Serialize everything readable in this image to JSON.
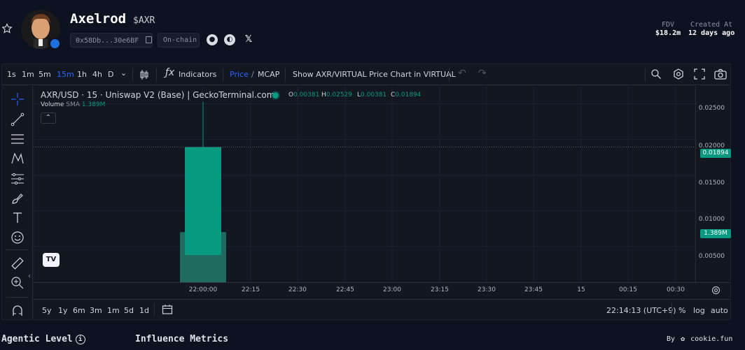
{
  "token": {
    "name": "Axelrod",
    "ticker": "$AXR",
    "address": "0x58Db...30e6BF",
    "chain_badge": "On-chain"
  },
  "stats": {
    "fdv_label": "FDV",
    "fdv_value": "$18.2m",
    "created_label": "Created At",
    "created_value": "12 days ago"
  },
  "toolbar": {
    "timeframes": [
      "1s",
      "1m",
      "5m",
      "15m",
      "1h",
      "4h",
      "D"
    ],
    "active_timeframe": "15m",
    "indicators_label": "Indicators",
    "price_label": "Price",
    "mcap_label": "MCAP",
    "show_chart_label": "Show AXR/VIRTUAL Price Chart in VIRTUAL"
  },
  "legend": {
    "title": "AXR/USD · 15 · Uniswap V2 (Base) | GeckoTerminal.com",
    "o_label": "O",
    "o_value": "0.00381",
    "h_label": "H",
    "h_value": "0.02529",
    "l_label": "L",
    "l_value": "0.00381",
    "c_label": "C",
    "c_value": "0.01894",
    "volume_label": "Volume",
    "sma_label": "SMA",
    "volume_value": "1.389M"
  },
  "yaxis": {
    "ticks": [
      "0.02500",
      "0.02000",
      "0.01500",
      "0.01000",
      "0.00500"
    ],
    "price_badge": "0.01894",
    "volume_badge": "1.389M"
  },
  "xaxis": {
    "ticks": [
      "22:00:00",
      "22:15",
      "22:30",
      "22:45",
      "23:00",
      "23:15",
      "23:30",
      "23:45",
      "15",
      "00:15",
      "00:30"
    ]
  },
  "bottombar": {
    "ranges": [
      "5y",
      "1y",
      "6m",
      "3m",
      "1m",
      "5d",
      "1d"
    ],
    "clock": "22:14:13 (UTC+9)",
    "percent_label": "%",
    "log_label": "log",
    "auto_label": "auto"
  },
  "footer": {
    "agentic_level": "Agentic Level",
    "influence_metrics": "Influence Metrics",
    "by_label": "By",
    "brand": "cookie.fun"
  },
  "chart_data": {
    "type": "candlestick",
    "x": [
      "22:00"
    ],
    "open": [
      0.00381
    ],
    "high": [
      0.02529
    ],
    "low": [
      0.00381
    ],
    "close": [
      0.01894
    ],
    "volume": [
      1389000
    ],
    "ylim": [
      0.0,
      0.0275
    ],
    "grid": true,
    "colors": {
      "up": "#089981",
      "volume": "#1f6b5f"
    }
  }
}
